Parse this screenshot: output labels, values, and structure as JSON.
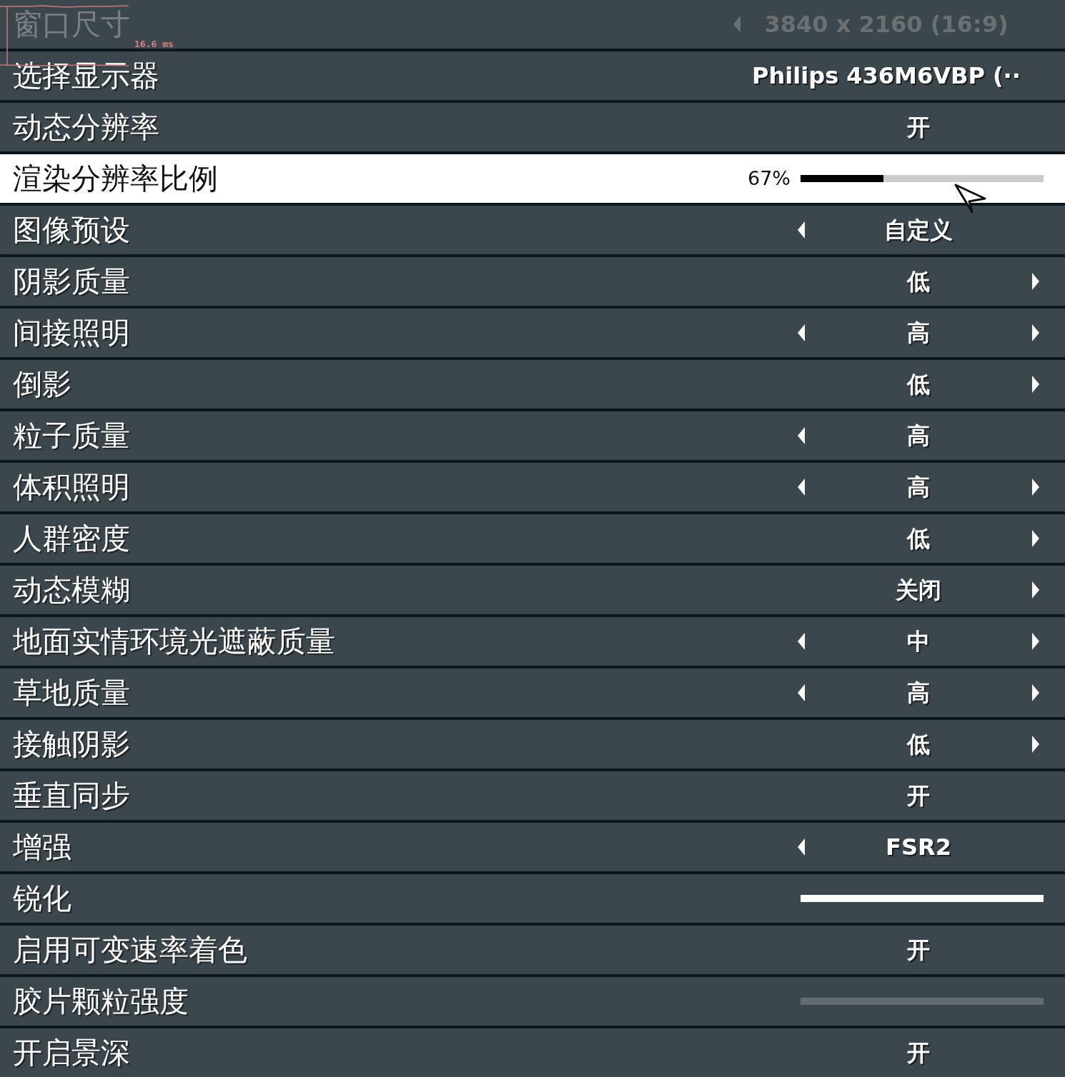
{
  "overlay": {
    "frame_time": "16.6 ms"
  },
  "settings": [
    {
      "kind": "choice",
      "label": "窗口尺寸",
      "value": "3840 x 2160 (16:9)",
      "has_prev": true,
      "has_next": false,
      "disabled": true,
      "selected": false
    },
    {
      "kind": "choice",
      "label": "选择显示器",
      "value": "Philips 436M6VBP (··",
      "has_prev": false,
      "has_next": false,
      "disabled": false,
      "selected": false
    },
    {
      "kind": "choice",
      "label": "动态分辨率",
      "value": "开",
      "has_prev": false,
      "has_next": false,
      "disabled": false,
      "selected": false
    },
    {
      "kind": "slider",
      "label": "渲染分辨率比例",
      "reading": "67%",
      "level": 0.34,
      "disabled": false,
      "selected": true
    },
    {
      "kind": "choice",
      "label": "图像预设",
      "value": "自定义",
      "has_prev": true,
      "has_next": false,
      "disabled": false,
      "selected": false
    },
    {
      "kind": "choice",
      "label": "阴影质量",
      "value": "低",
      "has_prev": false,
      "has_next": true,
      "disabled": false,
      "selected": false
    },
    {
      "kind": "choice",
      "label": "间接照明",
      "value": "高",
      "has_prev": true,
      "has_next": true,
      "disabled": false,
      "selected": false
    },
    {
      "kind": "choice",
      "label": "倒影",
      "value": "低",
      "has_prev": false,
      "has_next": true,
      "disabled": false,
      "selected": false
    },
    {
      "kind": "choice",
      "label": "粒子质量",
      "value": "高",
      "has_prev": true,
      "has_next": false,
      "disabled": false,
      "selected": false
    },
    {
      "kind": "choice",
      "label": "体积照明",
      "value": "高",
      "has_prev": true,
      "has_next": true,
      "disabled": false,
      "selected": false
    },
    {
      "kind": "choice",
      "label": "人群密度",
      "value": "低",
      "has_prev": false,
      "has_next": true,
      "disabled": false,
      "selected": false
    },
    {
      "kind": "choice",
      "label": "动态模糊",
      "value": "关闭",
      "has_prev": false,
      "has_next": true,
      "disabled": false,
      "selected": false
    },
    {
      "kind": "choice",
      "label": "地面实情环境光遮蔽质量",
      "value": "中",
      "has_prev": true,
      "has_next": true,
      "disabled": false,
      "selected": false
    },
    {
      "kind": "choice",
      "label": "草地质量",
      "value": "高",
      "has_prev": true,
      "has_next": true,
      "disabled": false,
      "selected": false
    },
    {
      "kind": "choice",
      "label": "接触阴影",
      "value": "低",
      "has_prev": false,
      "has_next": true,
      "disabled": false,
      "selected": false
    },
    {
      "kind": "choice",
      "label": "垂直同步",
      "value": "开",
      "has_prev": false,
      "has_next": false,
      "disabled": false,
      "selected": false
    },
    {
      "kind": "choice",
      "label": "增强",
      "value": "FSR2",
      "has_prev": true,
      "has_next": false,
      "disabled": false,
      "selected": false
    },
    {
      "kind": "slider",
      "label": "锐化",
      "level": 1,
      "disabled": false,
      "selected": false
    },
    {
      "kind": "choice",
      "label": "启用可变速率着色",
      "value": "开",
      "has_prev": false,
      "has_next": false,
      "disabled": false,
      "selected": false
    },
    {
      "kind": "slider",
      "label": "胶片颗粒强度",
      "level": 0,
      "disabled": false,
      "selected": false
    },
    {
      "kind": "choice",
      "label": "开启景深",
      "value": "开",
      "has_prev": false,
      "has_next": false,
      "disabled": false,
      "selected": false
    }
  ]
}
